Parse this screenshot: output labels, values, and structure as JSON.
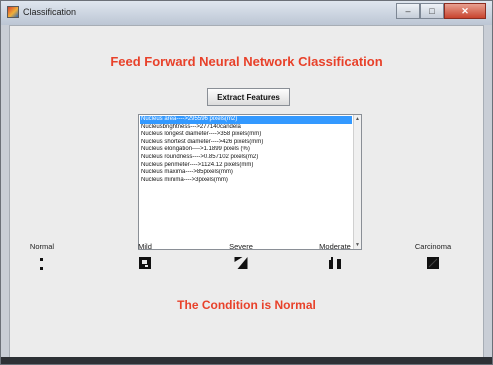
{
  "window": {
    "title": "Classification",
    "close_glyph": "✕",
    "minimize_glyph": "–",
    "maximize_glyph": "□"
  },
  "heading": "Feed Forward Neural Network Classification",
  "extract_button": "Extract Features",
  "features": [
    "Nucleus area---->295596 pixels(m2)",
    "Nucleusbrightness--->277140candela",
    "Nucleus longest diameter---->358 pixels(mm)",
    "Nucleus shortest diameter---->426 pixels(mm)",
    "Nucleus elongation---->1.1899 pixels (%)",
    "Nucleus roundness---->0.857102 pixels(m2)",
    "Nucleus perimeter---->1124.12 pixels(mm)",
    "Nucleus maxima---->85pixels(mm)",
    "Nucleus minima---->3pixels(mm)"
  ],
  "selected_feature_index": 0,
  "classes": [
    "Normal",
    "Mild",
    "Severe",
    "Moderate",
    "Carcinoma"
  ],
  "condition_text": "The Condition is Normal",
  "colors": {
    "accent": "#e8412a",
    "selection": "#3399ff"
  }
}
